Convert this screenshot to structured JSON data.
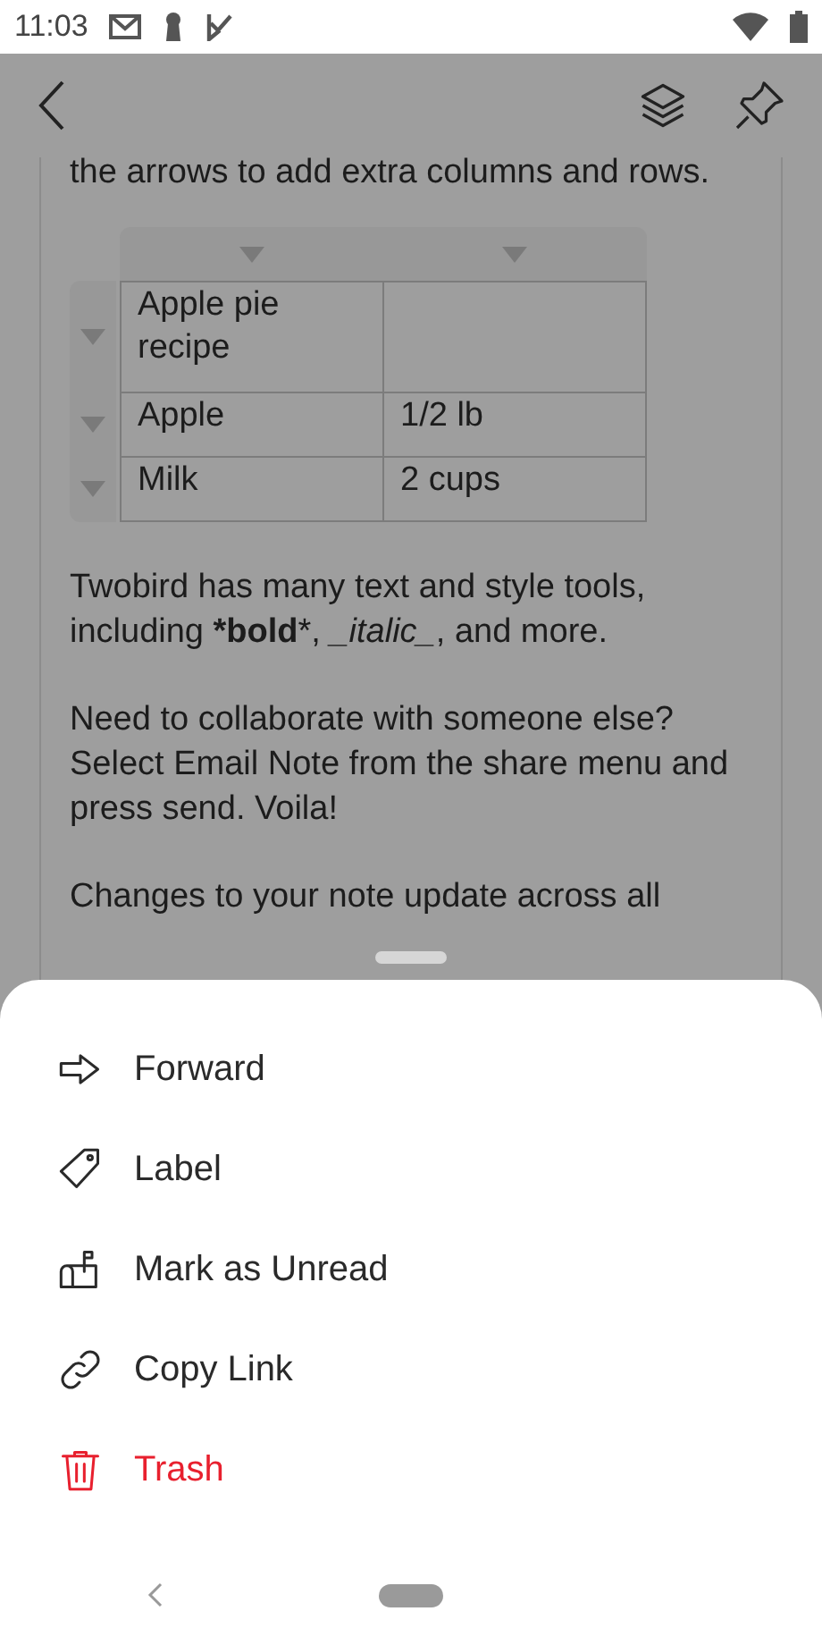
{
  "status_bar": {
    "time": "11:03"
  },
  "note": {
    "intro": "the arrows to add extra columns and rows.",
    "table": {
      "rows": [
        [
          "Apple pie recipe",
          ""
        ],
        [
          "Apple",
          "1/2 lb"
        ],
        [
          "Milk",
          "2 cups"
        ]
      ]
    },
    "paragraphs": [
      "Twobird has many text and style tools, including ***bold***, *_italic_*, and more.",
      "Need to collaborate with someone else? Select Email Note from the share menu and press send. Voila!",
      "Changes to your note update across all"
    ]
  },
  "menu": [
    {
      "kind": "forward",
      "label": "Forward",
      "danger": false
    },
    {
      "kind": "label",
      "label": "Label",
      "danger": false
    },
    {
      "kind": "unread",
      "label": "Mark as Unread",
      "danger": false
    },
    {
      "kind": "link",
      "label": "Copy Link",
      "danger": false
    },
    {
      "kind": "trash",
      "label": "Trash",
      "danger": true
    }
  ]
}
